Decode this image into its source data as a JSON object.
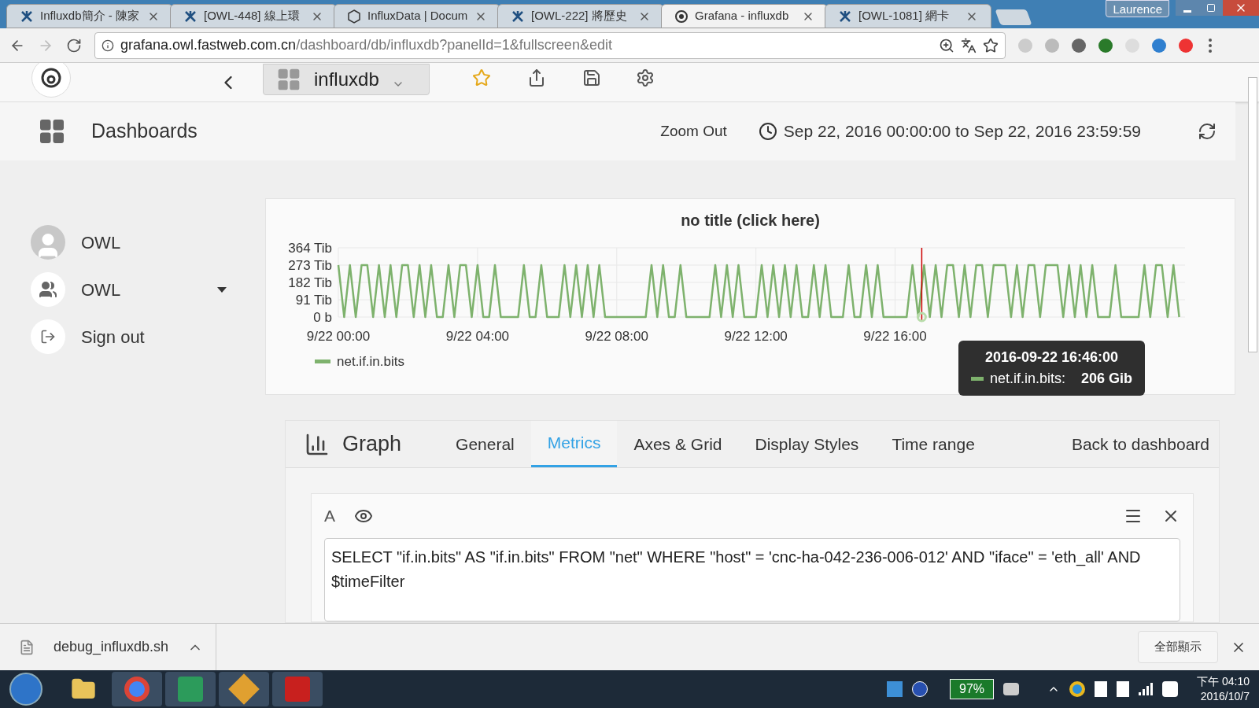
{
  "browser": {
    "tabs": [
      {
        "title": "Influxdb簡介 - 陳家",
        "kind": "jira",
        "selected": false
      },
      {
        "title": "[OWL-448] 線上環",
        "kind": "jira",
        "selected": false
      },
      {
        "title": "InfluxData | Docum",
        "kind": "influx",
        "selected": false
      },
      {
        "title": "[OWL-222] 將歷史",
        "kind": "jira",
        "selected": false
      },
      {
        "title": "Grafana - influxdb",
        "kind": "grafana",
        "selected": true
      },
      {
        "title": "[OWL-1081] 網卡",
        "kind": "jira",
        "selected": false
      }
    ],
    "profile": "Laurence",
    "url_host": "grafana.owl.fastweb.com.cn",
    "url_path": "/dashboard/db/influxdb?panelId=1&fullscreen&edit"
  },
  "navbar": {
    "dashboard": "influxdb"
  },
  "sidebar": {
    "header": "Dashboards",
    "items": [
      {
        "label": "OWL",
        "kind": "user"
      },
      {
        "label": "OWL",
        "kind": "org"
      },
      {
        "label": "Sign out",
        "kind": "signout"
      }
    ]
  },
  "timebar": {
    "zoom_out": "Zoom Out",
    "range": "Sep 22, 2016 00:00:00 to Sep 22, 2016 23:59:59"
  },
  "panel": {
    "title": "no title (click here)",
    "chart_data": {
      "type": "line",
      "ylim": [
        0,
        364
      ],
      "grid": true,
      "categories": [
        "9/22 00:00",
        null,
        null,
        null,
        null,
        null,
        null,
        null,
        null,
        null,
        null,
        null,
        null,
        null,
        null,
        null,
        null,
        null,
        null,
        null,
        null,
        null,
        null,
        null,
        "9/22 04:00",
        null,
        null,
        null,
        null,
        null,
        null,
        null,
        null,
        null,
        null,
        null,
        null,
        null,
        null,
        null,
        null,
        null,
        null,
        null,
        null,
        null,
        null,
        null,
        "9/22 08:00",
        null,
        null,
        null,
        null,
        null,
        null,
        null,
        null,
        null,
        null,
        null,
        null,
        null,
        null,
        null,
        null,
        null,
        null,
        null,
        null,
        null,
        null,
        null,
        "9/22 12:00",
        null,
        null,
        null,
        null,
        null,
        null,
        null,
        null,
        null,
        null,
        null,
        null,
        null,
        null,
        null,
        null,
        null,
        null,
        null,
        null,
        null,
        null,
        null,
        "9/22 16:00",
        null,
        null,
        null,
        null,
        null,
        null,
        null,
        null,
        null,
        null,
        null,
        null,
        null,
        null,
        null,
        null,
        null,
        null,
        null,
        null,
        null,
        null,
        null,
        null,
        null,
        null,
        null,
        null,
        null,
        null,
        null,
        null,
        null,
        null,
        null,
        null,
        null,
        null,
        null,
        null,
        null,
        null,
        null,
        null,
        null,
        null,
        null,
        null,
        null
      ],
      "yticks": [
        {
          "value": 364,
          "label": "364 Tib"
        },
        {
          "value": 273,
          "label": "273 Tib"
        },
        {
          "value": 182,
          "label": "182 Tib"
        },
        {
          "value": 91,
          "label": "91 Tib"
        },
        {
          "value": 0,
          "label": "0 b"
        }
      ],
      "series": [
        {
          "name": "net.if.in.bits",
          "color": "#7eb26d",
          "values": [
            273,
            0,
            273,
            0,
            273,
            273,
            0,
            273,
            0,
            273,
            0,
            273,
            273,
            0,
            273,
            0,
            273,
            0,
            0,
            273,
            0,
            273,
            273,
            0,
            273,
            0,
            0,
            273,
            0,
            0,
            0,
            0,
            273,
            0,
            0,
            273,
            0,
            0,
            0,
            273,
            0,
            273,
            0,
            273,
            0,
            273,
            0,
            0,
            0,
            0,
            0,
            0,
            0,
            0,
            273,
            0,
            273,
            0,
            0,
            273,
            0,
            0,
            0,
            0,
            0,
            273,
            0,
            273,
            0,
            273,
            0,
            0,
            0,
            273,
            0,
            273,
            0,
            273,
            0,
            273,
            0,
            0,
            273,
            0,
            273,
            0,
            0,
            0,
            273,
            0,
            0,
            273,
            0,
            273,
            0,
            0,
            0,
            0,
            0,
            273,
            0,
            273,
            0,
            273,
            0,
            273,
            273,
            0,
            273,
            0,
            273,
            273,
            0,
            273,
            273,
            273,
            0,
            273,
            0,
            273,
            273,
            0,
            273,
            273,
            273,
            0,
            273,
            0,
            273,
            0,
            273,
            0,
            0,
            0,
            273,
            0,
            0,
            0,
            0,
            273,
            0,
            273,
            273,
            0,
            273,
            0
          ]
        }
      ]
    },
    "tooltip": {
      "time": "2016-09-22 16:46:00",
      "series": "net.if.in.bits:",
      "value": "206 Gib"
    }
  },
  "editor": {
    "title": "Graph",
    "tabs": [
      {
        "label": "General",
        "selected": false
      },
      {
        "label": "Metrics",
        "selected": true
      },
      {
        "label": "Axes & Grid",
        "selected": false
      },
      {
        "label": "Display Styles",
        "selected": false
      },
      {
        "label": "Time range",
        "selected": false
      }
    ],
    "back": "Back to dashboard",
    "query": {
      "ref": "A",
      "text": "SELECT \"if.in.bits\" AS \"if.in.bits\" FROM \"net\" WHERE \"host\" = 'cnc-ha-042-236-006-012' AND \"iface\" = 'eth_all' AND $timeFilter"
    }
  },
  "download_bar": {
    "file": "debug_influxdb.sh",
    "show_all": "全部顯示"
  },
  "taskbar": {
    "battery": "97%",
    "time": "下午 04:10",
    "date": "2016/10/7"
  }
}
